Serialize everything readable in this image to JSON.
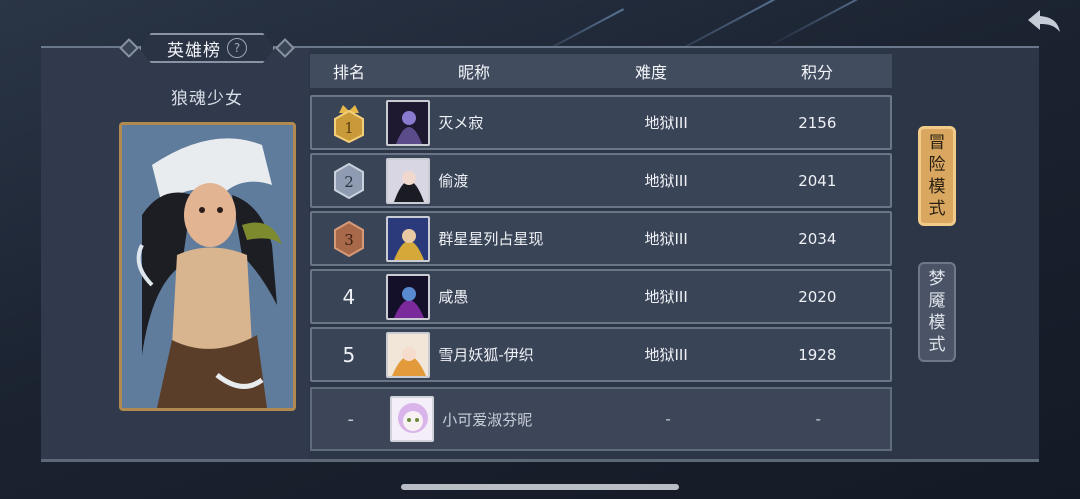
{
  "title": "英雄榜",
  "help_glyph": "?",
  "hero_name": "狼魂少女",
  "table": {
    "headers": {
      "rank": "排名",
      "nickname": "昵称",
      "difficulty": "难度",
      "score": "积分"
    },
    "rows": [
      {
        "rank": "1",
        "name": "灭メ寂",
        "difficulty": "地狱III",
        "score": "2156",
        "medal": "gold"
      },
      {
        "rank": "2",
        "name": "偷渡",
        "difficulty": "地狱III",
        "score": "2041",
        "medal": "silver"
      },
      {
        "rank": "3",
        "name": "群星星列占星现",
        "difficulty": "地狱III",
        "score": "2034",
        "medal": "bronze"
      },
      {
        "rank": "4",
        "name": "咸愚",
        "difficulty": "地狱III",
        "score": "2020",
        "medal": ""
      },
      {
        "rank": "5",
        "name": "雪月妖狐-伊织",
        "difficulty": "地狱III",
        "score": "1928",
        "medal": ""
      }
    ],
    "self": {
      "rank": "-",
      "name": "小可爱淑芬昵",
      "difficulty": "-",
      "score": "-"
    }
  },
  "modes": [
    {
      "label": "冒险模式",
      "chars": [
        "冒",
        "险",
        "模",
        "式"
      ],
      "active": true
    },
    {
      "label": "梦魇模式",
      "chars": [
        "梦",
        "魇",
        "模",
        "式"
      ],
      "active": false
    }
  ],
  "icons": {
    "back": "back-arrow-icon",
    "help": "help-icon"
  },
  "colors": {
    "accent_gold": "#d9a760",
    "panel": "#2c3647",
    "row": "#3a4457"
  }
}
